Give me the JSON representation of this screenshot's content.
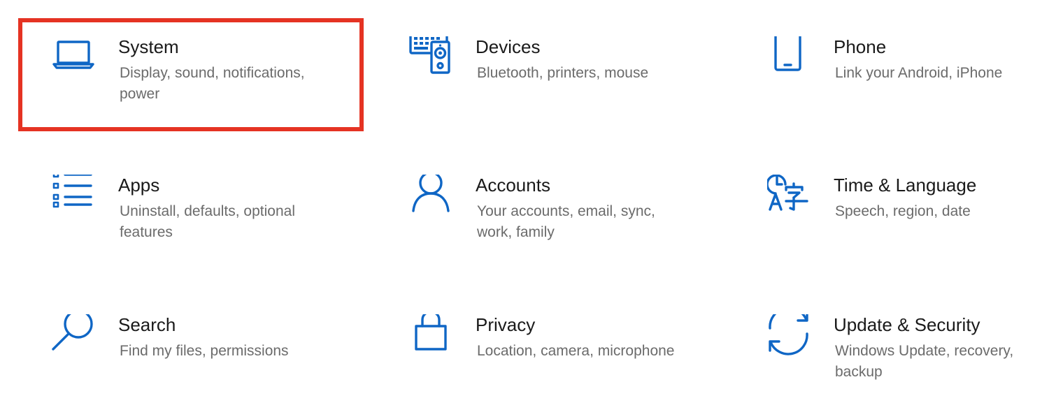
{
  "tiles": [
    {
      "key": "system",
      "title": "System",
      "desc": "Display, sound, notifications, power",
      "icon": "laptop-icon"
    },
    {
      "key": "devices",
      "title": "Devices",
      "desc": "Bluetooth, printers, mouse",
      "icon": "keyboard-speaker-icon"
    },
    {
      "key": "phone",
      "title": "Phone",
      "desc": "Link your Android, iPhone",
      "icon": "phone-icon"
    },
    {
      "key": "apps",
      "title": "Apps",
      "desc": "Uninstall, defaults, optional features",
      "icon": "app-list-icon"
    },
    {
      "key": "accounts",
      "title": "Accounts",
      "desc": "Your accounts, email, sync, work, family",
      "icon": "person-icon"
    },
    {
      "key": "time_language",
      "title": "Time & Language",
      "desc": "Speech, region, date",
      "icon": "clock-language-icon"
    },
    {
      "key": "search",
      "title": "Search",
      "desc": "Find my files, permissions",
      "icon": "magnifier-icon"
    },
    {
      "key": "privacy",
      "title": "Privacy",
      "desc": "Location, camera, microphone",
      "icon": "padlock-icon"
    },
    {
      "key": "update_security",
      "title": "Update & Security",
      "desc": "Windows Update, recovery, backup",
      "icon": "sync-arrows-icon"
    }
  ],
  "colors": {
    "accent": "#0f66c5",
    "highlight": "#e53323",
    "title_text": "#1a1a1a",
    "description_text": "#6b6b6b"
  },
  "selected_tile": "system"
}
